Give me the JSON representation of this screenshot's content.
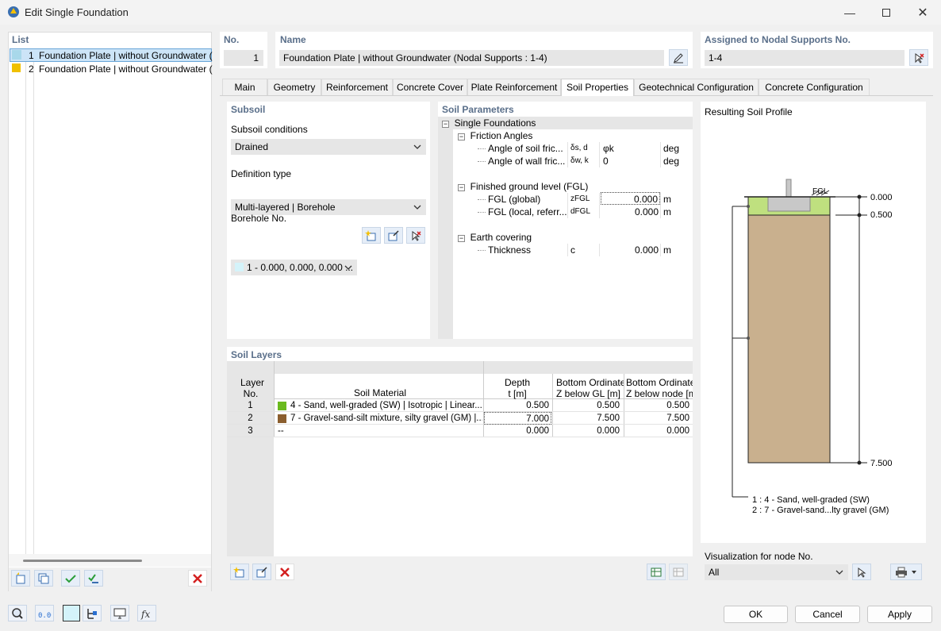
{
  "window": {
    "title": "Edit Single Foundation"
  },
  "list": {
    "header": "List",
    "items": [
      {
        "num": "1",
        "label": "Foundation Plate | without Groundwater (",
        "color": "#a8d8ea"
      },
      {
        "num": "2",
        "label": "Foundation Plate | without Groundwater (",
        "color": "#f0c000"
      }
    ]
  },
  "header": {
    "no_label": "No.",
    "no_value": "1",
    "name_label": "Name",
    "name_value": "Foundation Plate | without Groundwater (Nodal Supports : 1-4)",
    "assigned_label": "Assigned to Nodal Supports No.",
    "assigned_value": "1-4"
  },
  "tabs": [
    "Main",
    "Geometry",
    "Reinforcement",
    "Concrete Cover",
    "Plate Reinforcement",
    "Soil Properties",
    "Geotechnical Configuration",
    "Concrete Configuration"
  ],
  "active_tab": "Soil Properties",
  "subsoil": {
    "title": "Subsoil",
    "conditions_label": "Subsoil conditions",
    "conditions_value": "Drained",
    "deftype_label": "Definition type",
    "deftype_value": "Multi-layered | Borehole",
    "borehole_label": "Borehole No.",
    "borehole_value": "1 - 0.000, 0.000, 0.000 ..."
  },
  "soil_params": {
    "title": "Soil Parameters",
    "root": "Single Foundations",
    "friction": "Friction Angles",
    "r1_name": "Angle of soil fric...",
    "r1_sym": "δs, d",
    "r1_val": "φk",
    "r1_unit": "deg",
    "r2_name": "Angle of wall fric...",
    "r2_sym": "δw, k",
    "r2_val": "0",
    "r2_unit": "deg",
    "fgl": "Finished ground level (FGL)",
    "r3_name": "FGL (global)",
    "r3_sym": "zFGL",
    "r3_val": "0.000",
    "r3_unit": "m",
    "r4_name": "FGL (local, referr...",
    "r4_sym": "dFGL",
    "r4_val": "0.000",
    "r4_unit": "m",
    "earth": "Earth covering",
    "r5_name": "Thickness",
    "r5_sym": "c",
    "r5_val": "0.000",
    "r5_unit": "m"
  },
  "soil_layers": {
    "title": "Soil Layers",
    "col_layer": "Layer",
    "col_layer2": "No.",
    "col_material": "Soil Material",
    "col_depth": "Depth",
    "col_depth2": "t [m]",
    "col_bgl": "Bottom Ordinate",
    "col_bgl2": "Z below GL [m]",
    "col_bnode": "Bottom Ordinate",
    "col_bnode2": "Z below node [m]",
    "rows": [
      {
        "no": "1",
        "material": "4 - Sand, well-graded (SW) | Isotropic | Linear...",
        "color": "#6aba1e",
        "depth": "0.500",
        "bgl": "0.500",
        "bnode": "0.500"
      },
      {
        "no": "2",
        "material": "7 - Gravel-sand-silt mixture, silty gravel (GM) |...",
        "color": "#8b5e2e",
        "depth": "7.000",
        "bgl": "7.500",
        "bnode": "7.500"
      },
      {
        "no": "3",
        "material": "--",
        "color": "",
        "depth": "0.000",
        "bgl": "0.000",
        "bnode": "0.000"
      }
    ]
  },
  "profile": {
    "title": "Resulting Soil Profile",
    "fgl": "FGL",
    "lvl0": "0.000",
    "lvl1": "0.500",
    "lvl2": "7.500",
    "legend1": "1 :  4 - Sand, well-graded (SW)",
    "legend2": "2 :  7 - Gravel-sand...lty gravel (GM)",
    "vis_label": "Visualization for node No.",
    "vis_value": "All",
    "colors": {
      "sand": "#bfe07f",
      "gravel": "#c9b08e"
    }
  },
  "buttons": {
    "ok": "OK",
    "cancel": "Cancel",
    "apply": "Apply"
  }
}
